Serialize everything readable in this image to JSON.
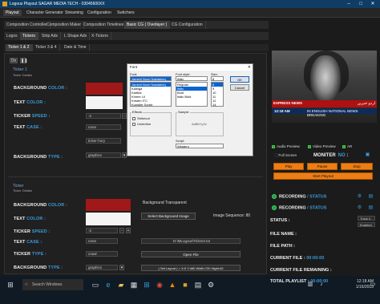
{
  "window": {
    "title": "Logous Playout SAGAR MEDIA TECH - 03045600XX"
  },
  "menu": [
    "Playout",
    "Character Generator",
    "Streaming",
    "Configuration",
    "Switchers"
  ],
  "playout_label": "Playout",
  "tabs_primary": [
    "Composition Controller",
    "Composition Maker",
    "Composition Timelines",
    "Basic CG ( Overlayer )",
    "CG Configuration"
  ],
  "tabs_secondary": [
    "Logos",
    "Tickers",
    "Strip Ads",
    "L Shape Ads",
    "X-Tickers"
  ],
  "tabs_tertiary": [
    "Ticker 1 & 2",
    "Ticker 3 & 4",
    "Date & Time"
  ],
  "on_label": "On",
  "ticker1": {
    "title": "Ticker 1",
    "subtitle": "Ticker Details",
    "bg_color_label_a": "BACKGROUND ",
    "bg_color_label_b": "COLOR :",
    "text_color_label_a": "TEXT ",
    "text_color_label_b": "COLOR :",
    "speed_label_a": "TICKER ",
    "speed_label_b": "SPEED :",
    "speed_value": "-2",
    "case_label_a": "TEXT ",
    "case_label_b": "CASE :",
    "case_value": "none",
    "type_value": "ticker-hory",
    "bg_type_label_a": "BACKGROUND ",
    "bg_type_label_b": "TYPE :",
    "bg_type_value": "graphics"
  },
  "ticker2": {
    "title": "Ticker",
    "subtitle": "Ticker Details",
    "bg_color_label_a": "BACKGROUND ",
    "bg_color_label_b": "COLOR :",
    "bg_transparent": "Background Transparent",
    "select_bg_image": "Select Background Image",
    "image_sequence": "Image Sequence: 80",
    "text_color_label_a": "TEXT ",
    "text_color_label_b": "COLOR :",
    "speed_label_a": "TICKER ",
    "speed_label_b": "SPEED :",
    "speed_value": "-2",
    "case_label_a": "TEXT ",
    "case_label_b": "CASE :",
    "case_value": "none",
    "file_path": "D:\\MLogous\\Ticker2.txt",
    "type_label_a": "TICKER ",
    "type_label_b": "TYPE :",
    "type_value": "crawl",
    "open_file": "Open File",
    "bg_type_label_a": "BACKGROUND ",
    "bg_type_label_b": "TYPE :",
    "bg_type_value": "graphics",
    "layout_value": "( Set Layout ) > X:0 Y:460 Width:720 Hight:40"
  },
  "font_dialog": {
    "title": "Font",
    "font_label": "Font:",
    "font_value": "Jameel Noori Nastaleeq",
    "style_label": "Font style:",
    "style_value": "Italic",
    "size_label": "Size:",
    "size_value": "8",
    "fonts": [
      "Jameel Noori Nastaleeq",
      "Kalinga",
      "Kartika",
      "Khmer UI",
      "Kristen ITC",
      "Kunstler Script"
    ],
    "styles": [
      "Regular",
      "Italic",
      "Bold",
      "Italic Bold"
    ],
    "sizes": [
      "8",
      "9",
      "10",
      "11",
      "12",
      "14",
      "16",
      "18"
    ],
    "ok": "OK",
    "cancel": "Cancel",
    "effects_label": "Effects",
    "strikeout": "Strikeout",
    "underline": "Underline",
    "sample_label": "Sample",
    "sample_text": "AaBbYyZz",
    "script_label": "Script:",
    "script_value": "Western"
  },
  "preview": {
    "ticker_brand": "EXPRESS NEWS",
    "ticker_urdu": "اردو خبریں",
    "time": "12:18 AM",
    "news": "IN ENGLISH NATIONAL NEWS BREAKING"
  },
  "right_panel": {
    "audio_preview": "Audio Preview",
    "video_preview": "Video Preview",
    "ar": "AR",
    "fullscreen": "Full Screen",
    "monitor_label": "MONITER",
    "monitor_value": "NO",
    "monitor_sep": " :",
    "play": "Play",
    "pause": "Pause",
    "stop": "Stop",
    "start_playout": "Start Playout",
    "recording_a": "RECORDING",
    "recording_b": " / STATUS",
    "status_label": "STATUS :",
    "track_value": "Track 0",
    "enabled_value": "Enabled",
    "file_name_label": "FILE NAME :",
    "file_path_label": "FILE PATH :",
    "current_file_label": "CURRENT FILE : ",
    "current_file_value": "00:00:00",
    "current_file_remaining_label": "CURRENT FILE REMAINING :",
    "total_playlist_label": "TOTAL PLAYLIST : ",
    "total_playlist_value": "00:00:00"
  },
  "taskbar": {
    "search": "Search Windows",
    "time": "12:18 AM",
    "date": "1/16/2018"
  }
}
